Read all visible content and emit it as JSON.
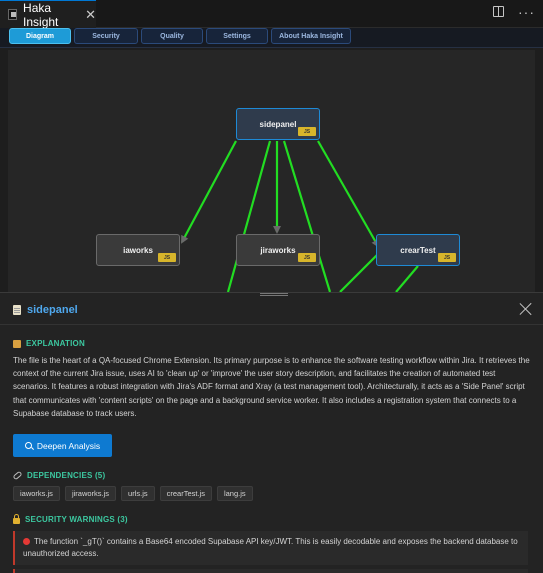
{
  "window": {
    "tab_title": "Haka Insight",
    "tab_close": "✕"
  },
  "nav": {
    "tabs": [
      {
        "label": "Diagram",
        "active": true
      },
      {
        "label": "Security",
        "active": false
      },
      {
        "label": "Quality",
        "active": false
      },
      {
        "label": "Settings",
        "active": false
      },
      {
        "label": "About Haka Insight",
        "active": false
      }
    ]
  },
  "diagram": {
    "nodes": [
      {
        "label": "sidepanel",
        "badge": "JS",
        "highlighted": true
      },
      {
        "label": "iaworks",
        "badge": "JS",
        "highlighted": false
      },
      {
        "label": "jiraworks",
        "badge": "JS",
        "highlighted": false
      },
      {
        "label": "crearTest",
        "badge": "JS",
        "highlighted": true
      }
    ],
    "edge_color": "#22dd22",
    "highlight_color": "#1e8ad6"
  },
  "panel": {
    "title": "sidepanel",
    "explanation_heading": "EXPLANATION",
    "explanation_text": "The file is the heart of a QA-focused Chrome Extension. Its primary purpose is to enhance the software testing workflow within Jira. It retrieves the context of the current Jira issue, uses AI to 'clean up' or 'improve' the user story description, and facilitates the creation of automated test scenarios. It features a robust integration with Jira's ADF format and Xray (a test management tool). Architecturally, it acts as a 'Side Panel' script that communicates with 'content scripts' on the page and a background service worker. It also includes a registration system that connects to a Supabase database to track users.",
    "deepen_button": "Deepen Analysis",
    "dependencies_heading": "DEPENDENCIES (5)",
    "dependencies": [
      "iaworks.js",
      "jiraworks.js",
      "urls.js",
      "crearTest.js",
      "lang.js"
    ],
    "security_heading": "SECURITY WARNINGS (3)",
    "warnings": [
      "The function `_gT()` contains a Base64 encoded Supabase API key/JWT. This is easily decodable and exposes the backend database to unauthorized access."
    ]
  }
}
